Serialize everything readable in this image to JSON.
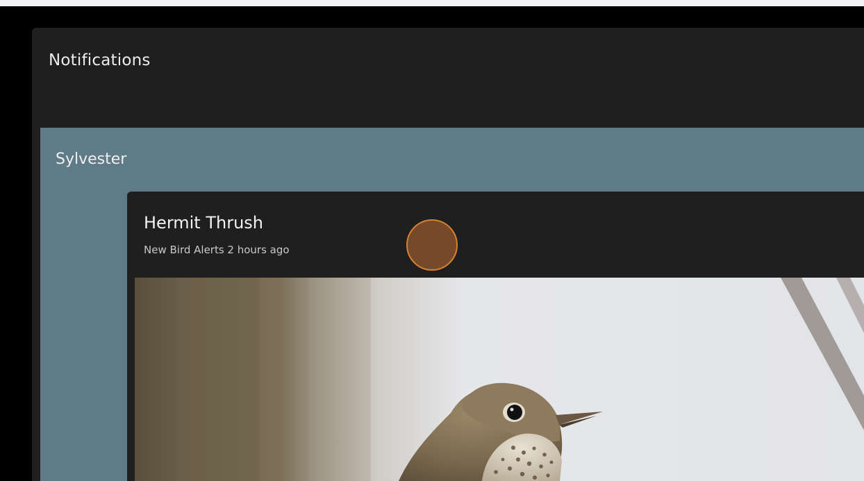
{
  "panel": {
    "title": "Notifications"
  },
  "group": {
    "title": "Sylvester"
  },
  "notification": {
    "title": "Hermit Thrush",
    "meta": "New Bird Alerts 2 hours ago",
    "image_subject": "hermit-thrush-photo"
  },
  "colors": {
    "panel_bg": "#1f1f1f",
    "group_bg": "#5f7b88",
    "cursor_fill": "#7a4c2a",
    "cursor_ring": "#d9822f"
  }
}
